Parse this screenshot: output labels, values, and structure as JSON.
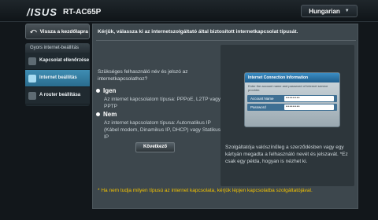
{
  "header": {
    "brand": "/ISUS",
    "model": "RT-AC65P",
    "language": "Hungarian"
  },
  "sidebar": {
    "back_label": "Vissza a kezdőlapra",
    "section_title": "Gyors internet-beállítás",
    "items": [
      {
        "label": "Kapcsolat ellenőrzése",
        "active": false
      },
      {
        "label": "Internet beállítás",
        "active": true
      },
      {
        "label": "A router beállítása",
        "active": false
      }
    ]
  },
  "main": {
    "title": "Kérjük, válassza ki az internetszolgáltató által biztosított internetkapcsolat típusát.",
    "question": "Szükséges felhasználó név és jelszó az internetkapcsolathoz?",
    "yes": {
      "title": "Igen",
      "desc": "Az internet kapcsolatom típusa: PPPoE, L2TP vagy PPTP"
    },
    "no": {
      "title": "Nem",
      "desc": "Az internet kapcsolatom típusa: Automatikus IP (Kábel modem, Dinamikus IP, DHCP) vagy Statikus IP"
    },
    "next_label": "Következő",
    "info_card": {
      "title": "Internet Connection Information",
      "subtitle": "Enter the account name and password of Internet service provider.",
      "account_label": "Account Name",
      "account_value": "••••••••",
      "password_label": "Password",
      "password_value": "••••••••"
    },
    "info_text": "Szolgáltatója valószínűleg a szerződésben vagy egy kártyán megadta a felhasználó nevét és jelszavát. *Ez csak egy példa, hogyan is nézhet ki.",
    "footnote": "* Ha nem tudja milyen típusú az internet kapcsolata, kérjük lépjen kapcsolatba szolgáltatójával."
  },
  "colors": {
    "accent": "#3f8db3",
    "footnote": "#f2c200"
  }
}
